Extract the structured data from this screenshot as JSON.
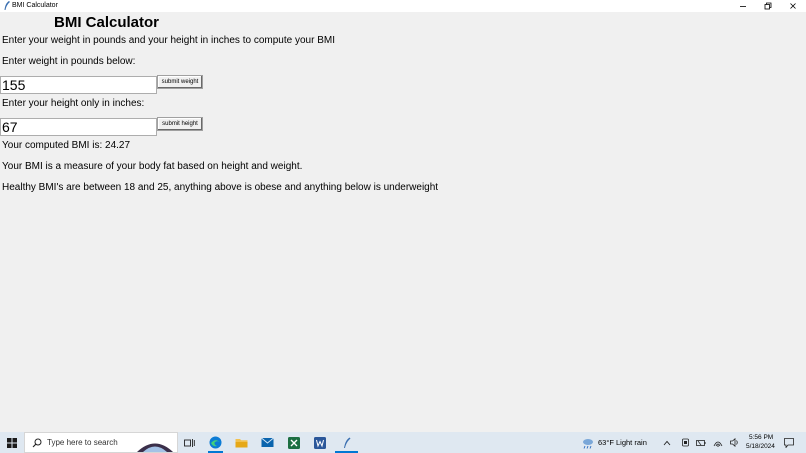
{
  "window": {
    "title": "BMI Calculator"
  },
  "app": {
    "heading": "BMI Calculator",
    "instructions": "Enter your weight in pounds and your height in inches to compute your BMI",
    "weight_prompt": "Enter weight in pounds below:",
    "weight_value": "155",
    "submit_weight_label": "submit weight",
    "height_prompt": "Enter your height only in inches:",
    "height_value": "67",
    "submit_height_label": "submit height",
    "result_text": "Your computed BMI is: 24.27",
    "description": "Your BMI is a measure of your body fat based on height and weight.",
    "healthy_range": "Healthy BMI's are between 18 and 25, anything above is obese and anything below is underweight"
  },
  "taskbar": {
    "search_placeholder": "Type here to search",
    "weather": "63°F  Light rain",
    "time": "5:56 PM",
    "date": "5/18/2024",
    "colors": {
      "background": "#dfe8f1",
      "accent": "#0078d4",
      "excel": "#1d6f42",
      "word": "#2b579a",
      "edge": "#0c7cd5",
      "folder": "#f2c14e"
    },
    "icons": [
      "windows-start-icon",
      "search-icon",
      "task-view-icon",
      "edge-icon",
      "file-explorer-icon",
      "mail-icon",
      "excel-icon",
      "word-icon",
      "python-tk-icon",
      "weather-icon",
      "chevron-up-icon",
      "meet-icon",
      "battery-icon",
      "network-icon",
      "volume-icon",
      "notification-icon"
    ]
  }
}
